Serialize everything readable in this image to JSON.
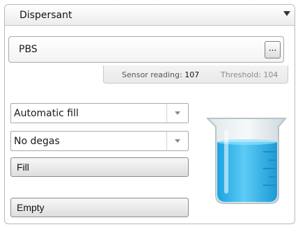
{
  "panel": {
    "title": "Dispersant"
  },
  "dispersant": {
    "value": "PBS",
    "browse_label": "..."
  },
  "readout": {
    "sensor_label": "Sensor reading:",
    "sensor_value": "107",
    "threshold_label": "Threshold: 104"
  },
  "controls": {
    "fill_mode": "Automatic fill",
    "degas_mode": "No degas",
    "fill_button": "Fill",
    "empty_button": "Empty"
  },
  "beaker": {
    "liquid_color": "#2fb5ee"
  },
  "icons": [
    "dropdown-arrow",
    "beaker-icon"
  ]
}
